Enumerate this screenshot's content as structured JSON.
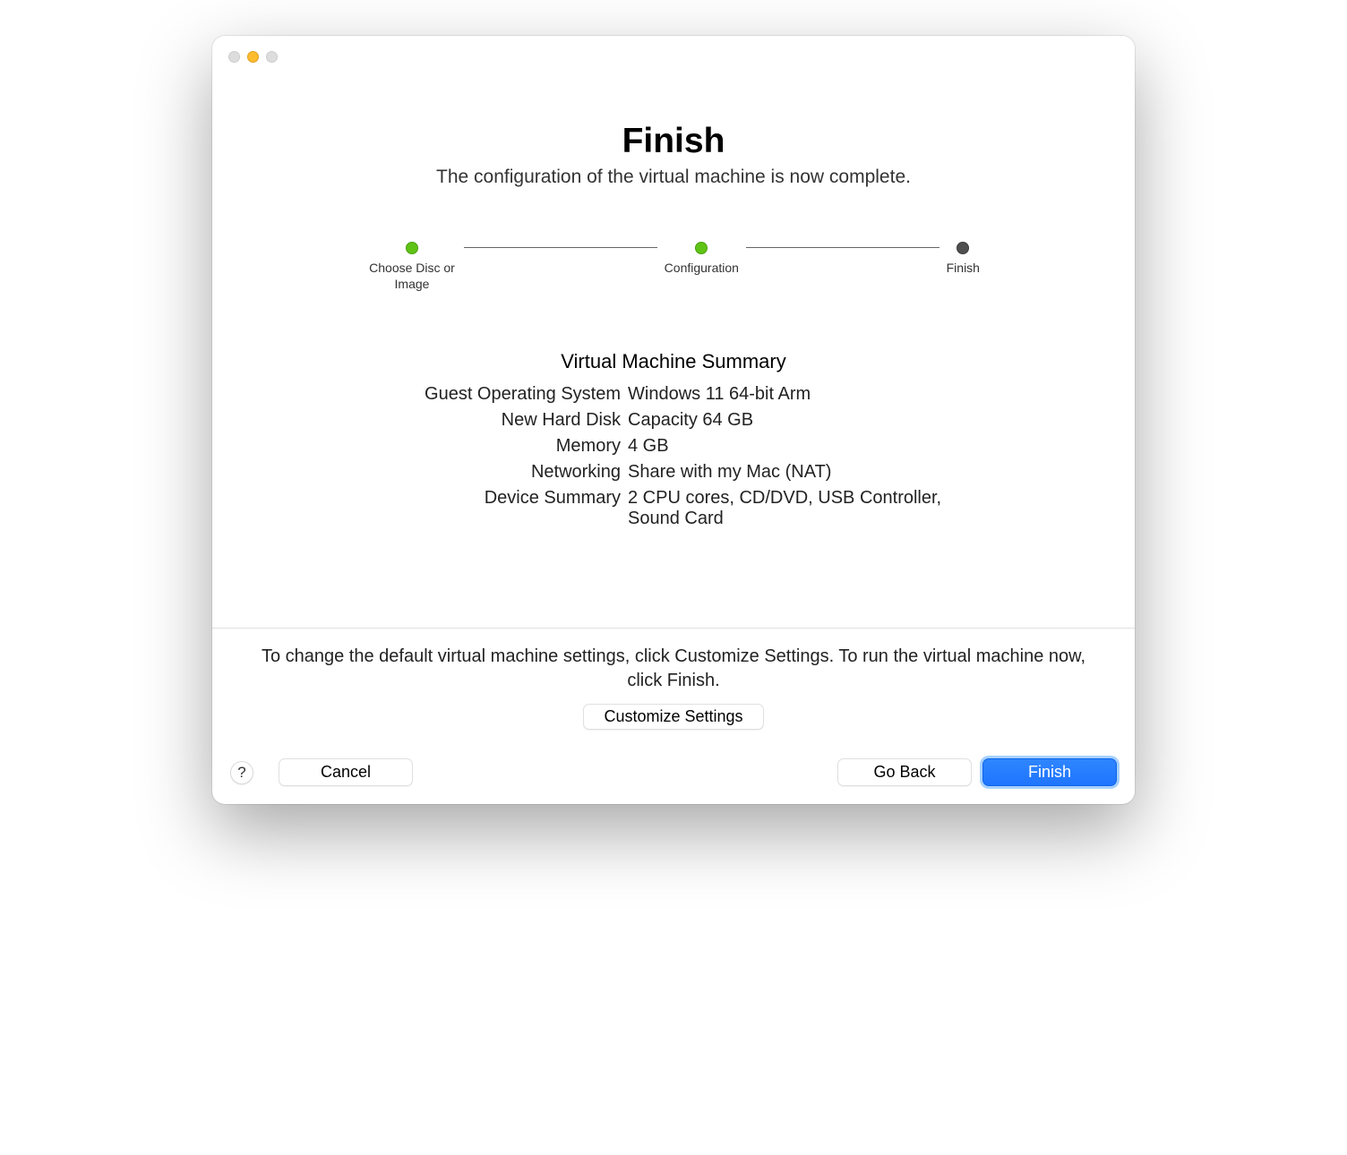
{
  "header": {
    "title": "Finish",
    "subtitle": "The configuration of the virtual machine is now complete."
  },
  "stepper": {
    "step1": "Choose Disc or Image",
    "step2": "Configuration",
    "step3": "Finish"
  },
  "summary": {
    "heading": "Virtual Machine Summary",
    "rows": {
      "os_label": "Guest Operating System",
      "os_value": "Windows 11 64-bit Arm",
      "disk_label": "New Hard Disk",
      "disk_value": "Capacity 64 GB",
      "mem_label": "Memory",
      "mem_value": "4 GB",
      "net_label": "Networking",
      "net_value": "Share with my Mac (NAT)",
      "dev_label": "Device Summary",
      "dev_value": "2 CPU cores, CD/DVD, USB Controller, Sound Card"
    }
  },
  "footnote": {
    "text": "To change the default virtual machine settings, click Customize Settings. To run the virtual machine now, click Finish.",
    "customize_label": "Customize Settings"
  },
  "buttons": {
    "help": "?",
    "cancel": "Cancel",
    "goback": "Go Back",
    "finish": "Finish"
  }
}
